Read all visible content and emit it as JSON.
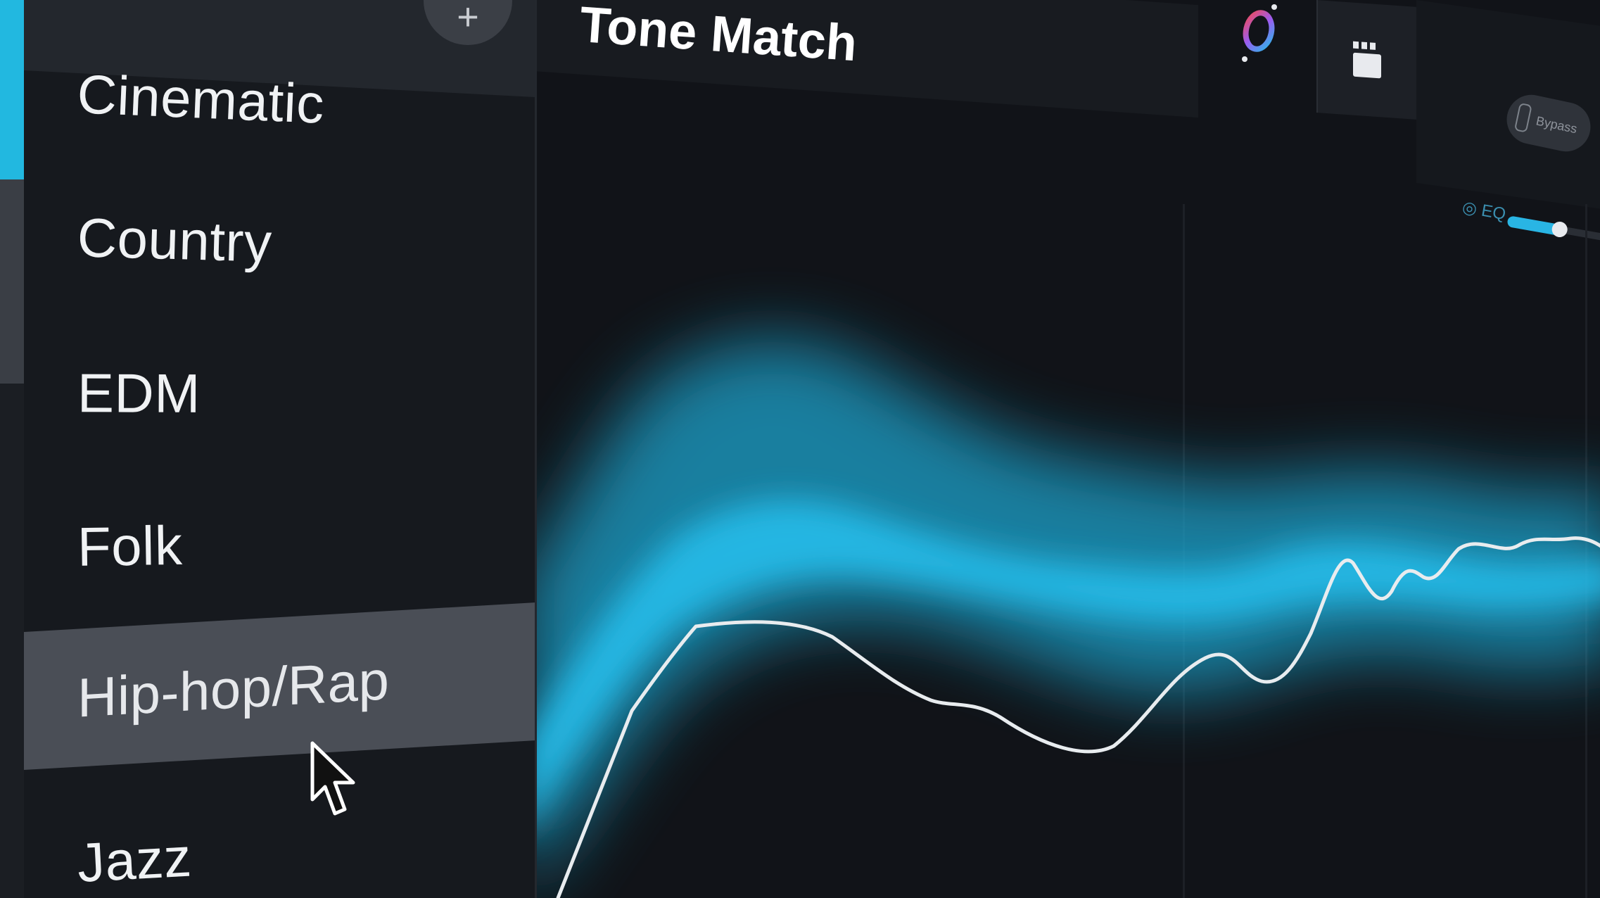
{
  "genre_list": {
    "add_button_label": "+",
    "selected": "Hip-hop/Rap",
    "items": [
      {
        "label": "Cinematic"
      },
      {
        "label": "Country"
      },
      {
        "label": "EDM"
      },
      {
        "label": "Folk"
      },
      {
        "label": "Hip-hop/Rap"
      },
      {
        "label": "Jazz"
      }
    ]
  },
  "module": {
    "title": "Tone Match"
  },
  "toolbar": {
    "logo_icon": "ozone-logo-icon",
    "film_icon": "film-clapper-icon",
    "toggle_label": "Bypass",
    "eq_label": "EQ",
    "eq_level": 0.5
  },
  "colors": {
    "accent": "#22b8e0",
    "panel": "#16191e",
    "selected_row": "#4a4e56",
    "curve": "#e8ecef",
    "target_band": "#1fb4e0"
  }
}
